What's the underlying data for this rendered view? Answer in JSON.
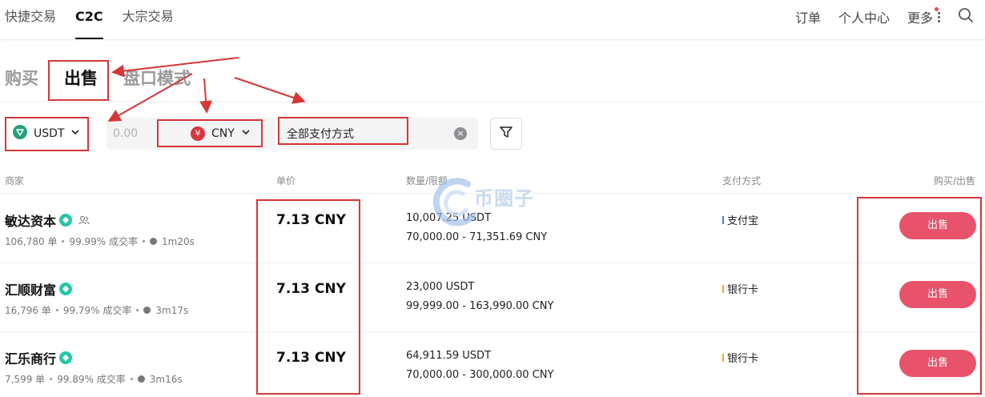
{
  "nav": {
    "tabs": [
      {
        "label": "快捷交易",
        "active": false
      },
      {
        "label": "C2C",
        "active": true
      },
      {
        "label": "大宗交易",
        "active": false
      }
    ],
    "right": {
      "orders": "订单",
      "personal": "个人中心",
      "more": "更多"
    }
  },
  "mode_tabs": [
    {
      "label": "购买",
      "active": false
    },
    {
      "label": "出售",
      "active": true
    },
    {
      "label": "盘口模式",
      "active": false
    }
  ],
  "filters": {
    "coin": "USDT",
    "amount_placeholder": "0.00",
    "fiat": "CNY",
    "fiat_symbol": "¥",
    "payment": "全部支付方式"
  },
  "table": {
    "headers": {
      "merchant": "商家",
      "price": "单价",
      "quantity": "数量/限额",
      "payment": "支付方式",
      "action": "购买/出售"
    },
    "rows": [
      {
        "merchant": "敏达资本",
        "orders": "106,780 单",
        "completion": "99.99% 成交率",
        "time": "1m20s",
        "price": "7.13 CNY",
        "quantity": "10,007.25 USDT",
        "limit": "70,000.00 - 71,351.69 CNY",
        "payment": "支付宝",
        "action": "出售"
      },
      {
        "merchant": "汇顺财富",
        "orders": "16,796 单",
        "completion": "99.79% 成交率",
        "time": "3m17s",
        "price": "7.13 CNY",
        "quantity": "23,000 USDT",
        "limit": "99,999.00 - 163,990.00 CNY",
        "payment": "银行卡",
        "action": "出售"
      },
      {
        "merchant": "汇乐商行",
        "orders": "7,599 单",
        "completion": "99.89% 成交率",
        "time": "3m16s",
        "price": "7.13 CNY",
        "quantity": "64,911.59 USDT",
        "limit": "70,000.00 - 300,000.00 CNY",
        "payment": "银行卡",
        "action": "出售"
      }
    ]
  },
  "watermark": "币圈子",
  "colors": {
    "accent": "#e8526b",
    "annotation": "#d63636",
    "verify": "#23c7a6",
    "usdt": "#26a17b",
    "cny": "#d9363e"
  }
}
